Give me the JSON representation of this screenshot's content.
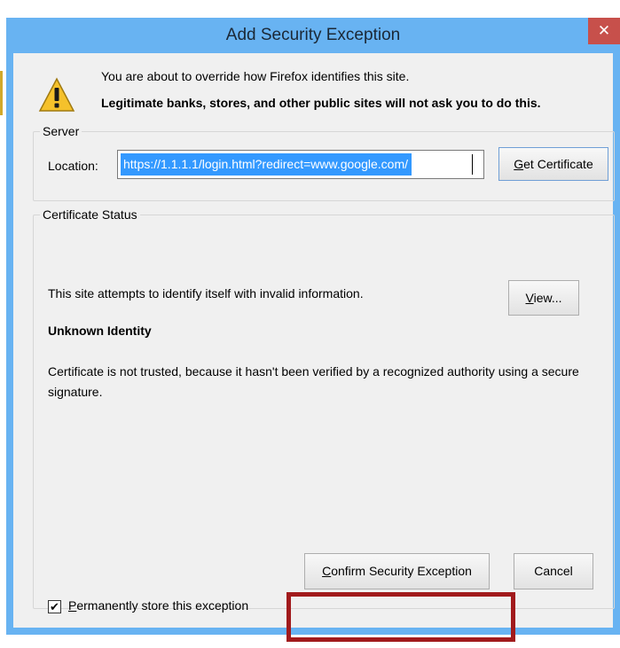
{
  "window": {
    "title": "Add Security Exception",
    "close_glyph": "✕"
  },
  "message": {
    "icon": "warning-icon",
    "line1": "You are about to override how Firefox identifies this site.",
    "line2": "Legitimate banks, stores, and other public sites will not ask you to do this."
  },
  "server": {
    "legend": "Server",
    "location_label": "Location:",
    "location_value": "https://1.1.1.1/login.html?redirect=www.google.com/",
    "get_cert_label_pre": "G",
    "get_cert_label_post": "et Certificate"
  },
  "status": {
    "legend": "Certificate Status",
    "text": "This site attempts to identify itself with invalid information.",
    "view_label_pre": "V",
    "view_label_post": "iew...",
    "heading": "Unknown Identity",
    "explanation": "Certificate is not trusted, because it hasn't been verified by a recognized authority using a secure signature."
  },
  "permanent": {
    "checked": true,
    "check_glyph": "✔",
    "label_pre": "P",
    "label_post": "ermanently store this exception"
  },
  "buttons": {
    "confirm_pre": "C",
    "confirm_post": "onfirm Security Exception",
    "cancel": "Cancel"
  },
  "colors": {
    "title_bar": "#68b3f2",
    "close": "#c7504b",
    "highlight": "#a11a1c",
    "selection": "#3399ff"
  }
}
